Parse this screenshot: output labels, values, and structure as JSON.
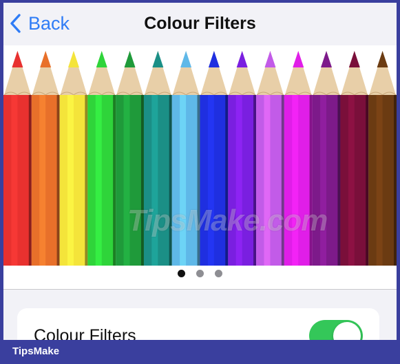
{
  "nav": {
    "back_label": "Back",
    "title": "Colour Filters"
  },
  "carousel": {
    "watermark": "TipsMake.com",
    "pencil_colors": [
      "#e8312f",
      "#e8702a",
      "#f4e43a",
      "#2fd43a",
      "#1f9a3a",
      "#1b8f86",
      "#5fb8e8",
      "#1f2fe0",
      "#7a1fe0",
      "#c25be8",
      "#e01ee8",
      "#7d1a8a",
      "#7a0f3a",
      "#6b3b12"
    ],
    "page_count": 3,
    "active_page": 1
  },
  "settings": {
    "row_label": "Colour Filters",
    "toggle_on": true
  },
  "footer": {
    "brand": "TipsMake"
  },
  "colors": {
    "accent": "#2f7cf6",
    "toggle_on": "#34c759",
    "frame_border": "#3a3f9e"
  }
}
